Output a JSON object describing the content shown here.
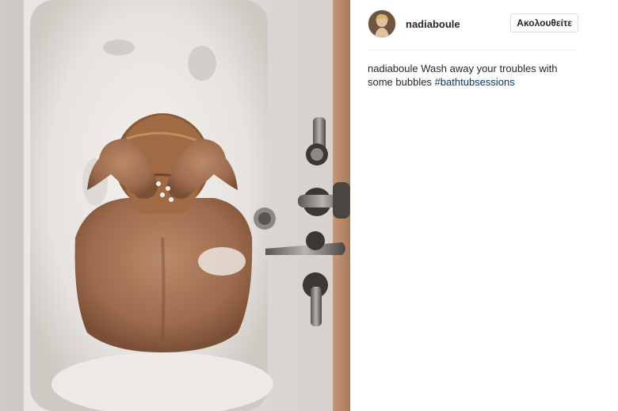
{
  "post": {
    "username": "nadiaboule",
    "follow_label": "Ακολουθείτε",
    "caption": {
      "username": "nadiaboule",
      "text": "Wash away your troubles with some bubbles",
      "hashtag": "#bathtubsessions"
    },
    "image": {
      "subject": "photo",
      "avatar_icon": "profile-photo"
    }
  },
  "colors": {
    "hashtag": "#003569",
    "text": "#262626",
    "button_border": "#dbdbdb",
    "divider": "#efefef"
  }
}
